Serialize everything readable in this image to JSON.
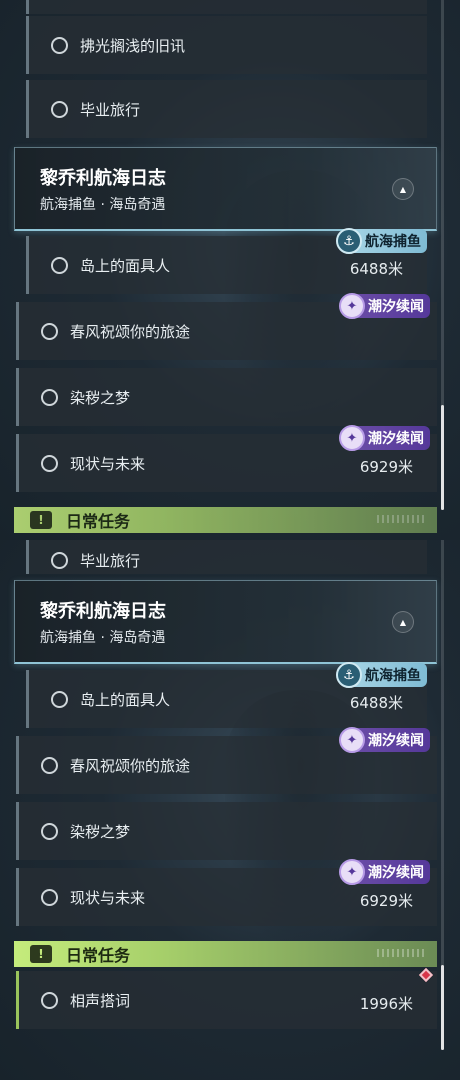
{
  "quest_group": {
    "title": "黎乔利航海日志",
    "subtitle": "航海捕鱼 · 海岛奇遇"
  },
  "badges": {
    "fishing": "航海捕鱼",
    "tide": "潮汐续闻"
  },
  "screen_a": {
    "prev_quests": [
      "拂光搁浅的旧讯",
      "毕业旅行"
    ],
    "quests": [
      {
        "name": "岛上的面具人",
        "distance": "6488米"
      },
      {
        "name": "春风祝颂你的旅途",
        "distance": ""
      },
      {
        "name": "染秽之梦",
        "distance": ""
      },
      {
        "name": "现状与未来",
        "distance": "6929米"
      }
    ],
    "daily_header": "日常任务"
  },
  "screen_b": {
    "cut_quest": "毕业旅行",
    "quests": [
      {
        "name": "岛上的面具人",
        "distance": "6488米"
      },
      {
        "name": "春风祝颂你的旅途",
        "distance": ""
      },
      {
        "name": "染秽之梦",
        "distance": ""
      },
      {
        "name": "现状与未来",
        "distance": "6929米"
      }
    ],
    "daily_header": "日常任务",
    "daily_quests": [
      {
        "name": "相声搭词",
        "distance": "1996米"
      }
    ]
  },
  "colors": {
    "daily_accent": "#c5ec7c",
    "tide_badge": "#6c4ea8",
    "fishing_badge": "#a9d6e6",
    "tracked_marker": "#d8364a"
  },
  "icons": {
    "toggle": "chevron-up-icon",
    "daily": "exclamation-icon",
    "badge_fishing": "fish-icon",
    "badge_tide": "tide-icon"
  }
}
